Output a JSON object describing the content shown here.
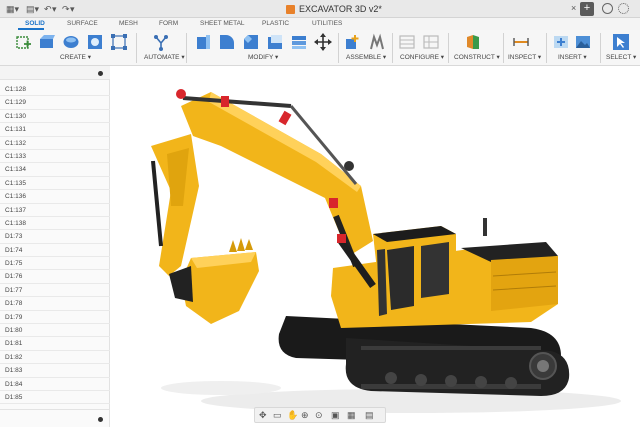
{
  "title_bar": {
    "doc_title": "EXCAVATOR 3D v2*",
    "close_tab": "×",
    "new_tab": "+",
    "menu_glyph": "▾",
    "undo_glyph": "↶",
    "redo_glyph": "↷"
  },
  "tabs": [
    {
      "label": "SOLID",
      "active": true
    },
    {
      "label": "SURFACE",
      "active": false
    },
    {
      "label": "MESH",
      "active": false
    },
    {
      "label": "FORM",
      "active": false
    },
    {
      "label": "SHEET METAL",
      "active": false
    },
    {
      "label": "PLASTIC",
      "active": false
    },
    {
      "label": "UTILITIES",
      "active": false
    }
  ],
  "ribbon": {
    "groups": [
      {
        "label": "CREATE ▾"
      },
      {
        "label": "AUTOMATE ▾"
      },
      {
        "label": "MODIFY ▾"
      },
      {
        "label": "ASSEMBLE ▾"
      },
      {
        "label": "CONFIGURE ▾"
      },
      {
        "label": "CONSTRUCT ▾"
      },
      {
        "label": "INSPECT ▾"
      },
      {
        "label": "INSERT ▾"
      },
      {
        "label": "SELECT ▾"
      }
    ]
  },
  "browser": {
    "items": [
      "C1:128",
      "C1:129",
      "C1:130",
      "C1:131",
      "C1:132",
      "C1:133",
      "C1:134",
      "C1:135",
      "C1:136",
      "C1:137",
      "C1:138",
      "D1:73",
      "D1:74",
      "D1:75",
      "D1:76",
      "D1:77",
      "D1:78",
      "D1:79",
      "D1:80",
      "D1:81",
      "D1:82",
      "D1:83",
      "D1:84",
      "D1:85"
    ]
  },
  "colors": {
    "accent": "#1a73c9",
    "excavator_yellow": "#f2b51a",
    "excavator_dark": "#1e1e1e",
    "cylinder_red": "#d8262c"
  }
}
